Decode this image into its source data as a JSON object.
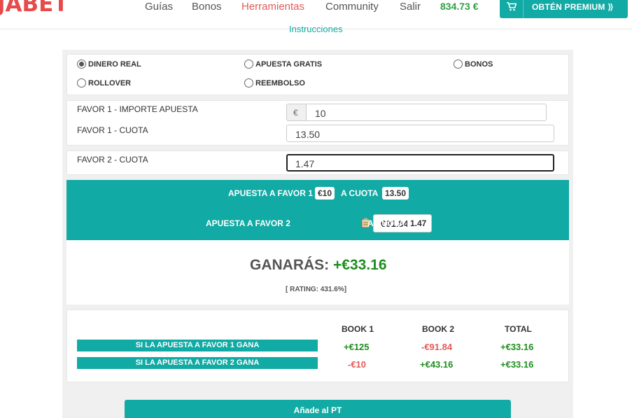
{
  "nav": {
    "logo": "JABET",
    "items": [
      "Guías",
      "Bonos",
      "Herramientas",
      "Community",
      "Salir"
    ],
    "balance": "834.73 €",
    "premium": "OBTÉN PREMIUM ⟫"
  },
  "instructions_link": "Instrucciones",
  "bet_types": {
    "dinero_real": "DINERO REAL",
    "apuesta_gratis": "APUESTA GRATIS",
    "bonos": "BONOS",
    "rollover": "ROLLOVER",
    "reembolso": "REEMBOLSO",
    "selected": "DINERO REAL"
  },
  "form": {
    "favor1_stake_label": "FAVOR 1 - IMPORTE APUESTA",
    "currency": "€",
    "favor1_stake": "10",
    "favor1_odds_label": "FAVOR 1 - CUOTA",
    "favor1_odds": "13.50",
    "favor2_odds_label": "FAVOR 2 - CUOTA",
    "favor2_odds": "1.47"
  },
  "result": {
    "line1_prefix": "APUESTA A FAVOR 1",
    "line1_stake": "€10",
    "a_cuota": "A CUOTA",
    "line1_odds": "13.50",
    "line2_prefix": "APUESTA A FAVOR 2",
    "line2_stake": "€91.84",
    "line2_odds": "1.47",
    "gain_label": "GANARÁS:",
    "gain_value": "+€33.16",
    "rating": "[ RATING: 431.6%]"
  },
  "table": {
    "headers": [
      "BOOK 1",
      "BOOK 2",
      "TOTAL"
    ],
    "rows": [
      {
        "label": "SI LA APUESTA A FAVOR 1 GANA",
        "book1": "+€125",
        "book2": "-€91.84",
        "total": "+€33.16"
      },
      {
        "label": "SI LA APUESTA A FAVOR 2 GANA",
        "book1": "-€10",
        "book2": "+€43.16",
        "total": "+€33.16"
      }
    ]
  },
  "add_button": "Añade al PT",
  "colors": {
    "accent": "#12aaa4",
    "positive": "#1e8e1e",
    "negative": "#e35a5a"
  }
}
